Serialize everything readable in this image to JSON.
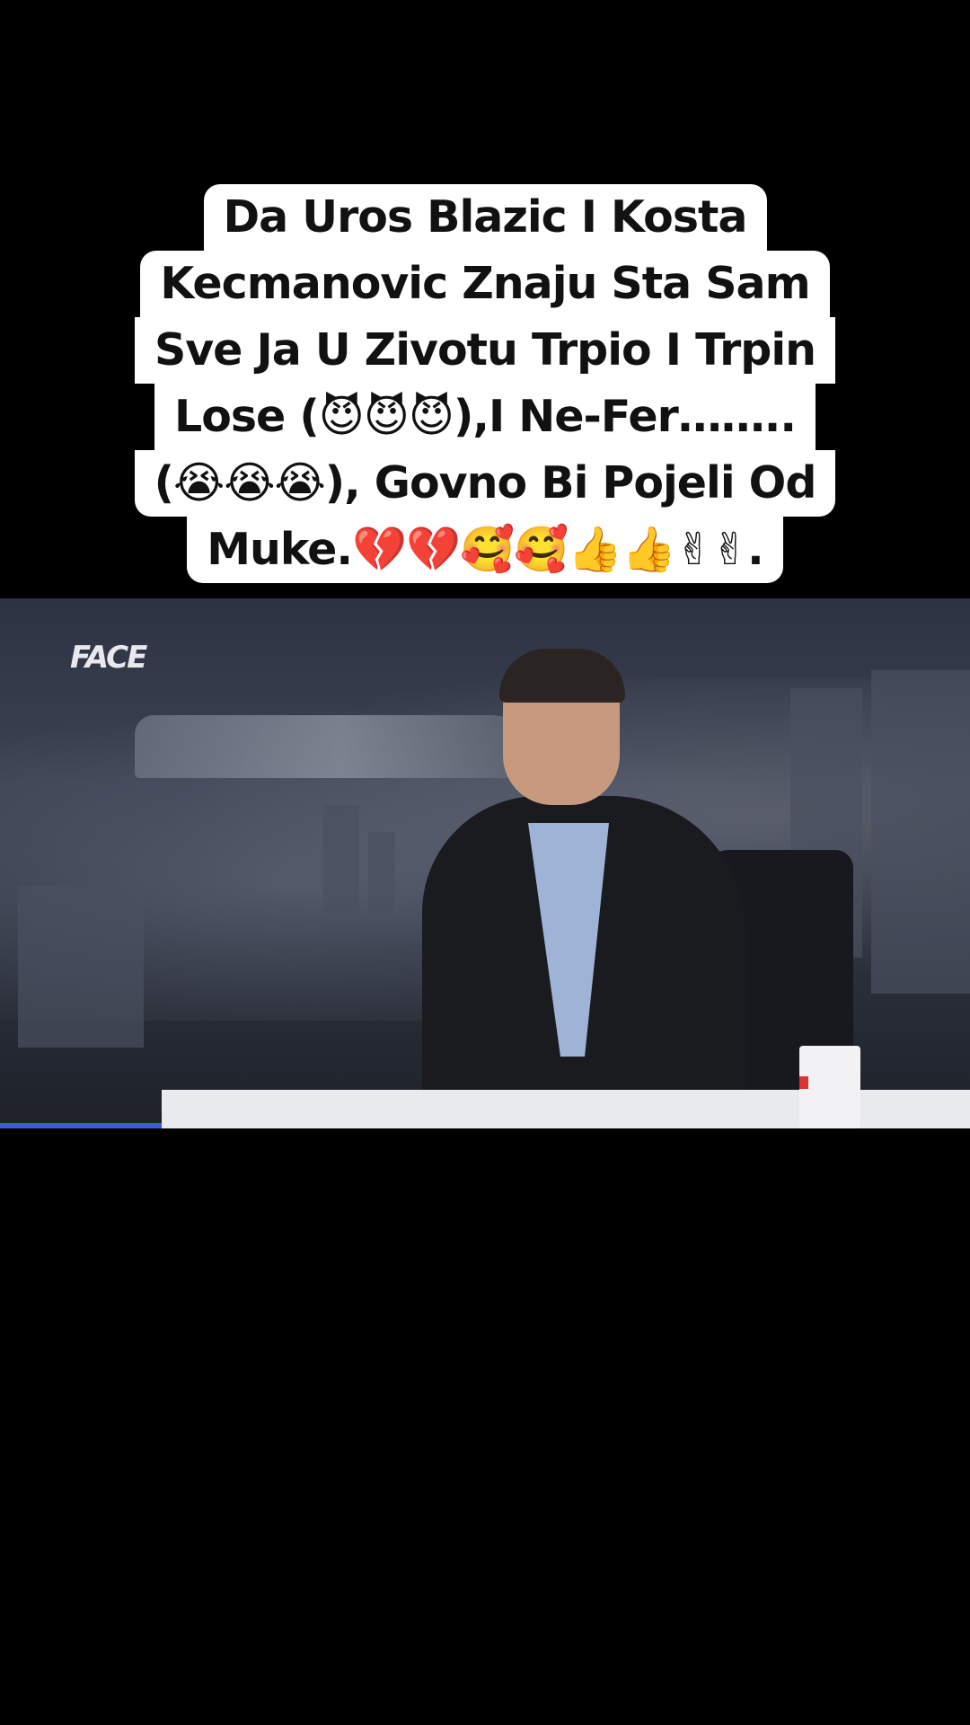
{
  "caption": {
    "lines": [
      "Da Uros Blazic I Kosta",
      "Kecmanovic Znaju Sta Sam",
      "Sve Ja U Zivotu Trpio I Trpin",
      "Lose (😈😈😈),I Ne-Fer……..",
      "(😭😭😭), Govno Bi Pojeli Od",
      "Muke.💔💔🥰🥰👍👍✌✌."
    ]
  },
  "video": {
    "channel_logo": "FACE"
  },
  "colors": {
    "background": "#000000",
    "caption_bg": "#ffffff",
    "caption_text": "#111111",
    "accent_line": "#3b5bd8"
  }
}
